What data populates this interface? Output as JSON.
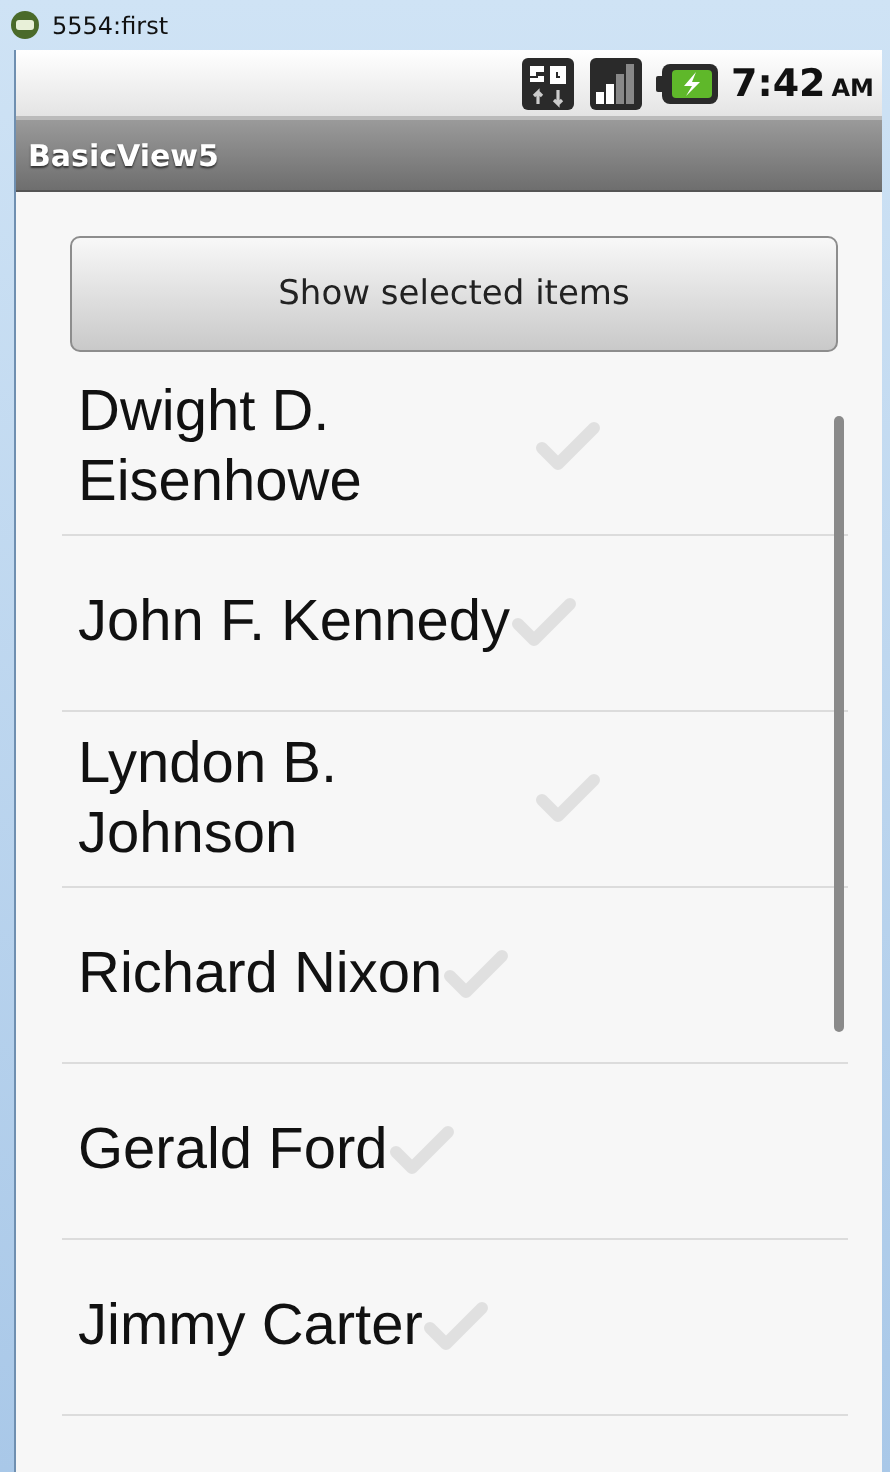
{
  "window": {
    "title": "5554:first"
  },
  "status_bar": {
    "time": "7:42",
    "meridiem": "AM"
  },
  "action_bar": {
    "title": "BasicView5"
  },
  "button": {
    "label": "Show selected items"
  },
  "items": [
    {
      "label": "Dwight D. Eisenhowe",
      "checked": false
    },
    {
      "label": "John F. Kennedy",
      "checked": false
    },
    {
      "label": "Lyndon B. Johnson",
      "checked": false
    },
    {
      "label": "Richard Nixon",
      "checked": false
    },
    {
      "label": "Gerald Ford",
      "checked": false
    },
    {
      "label": "Jimmy Carter",
      "checked": false
    }
  ]
}
